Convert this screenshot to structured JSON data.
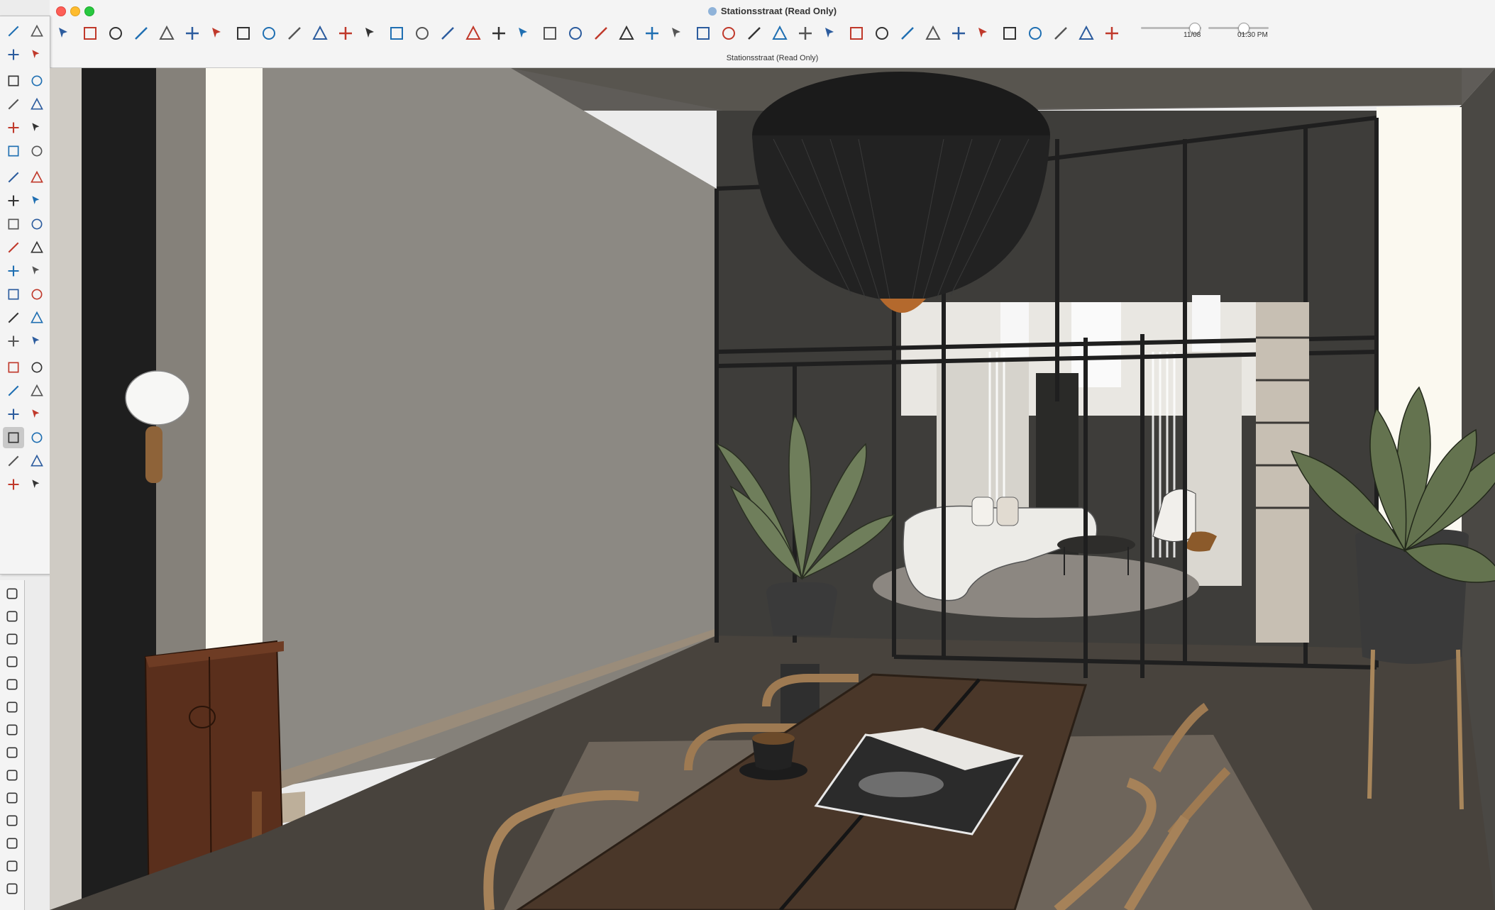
{
  "window": {
    "title": "Stationsstraat  (Read Only)",
    "subtitle": "Stationsstraat  (Read Only)"
  },
  "toolbar": {
    "tools": [
      "search",
      "select",
      "undo",
      "redo",
      "eraser",
      "pencil",
      "polygon",
      "rectangle",
      "push-pull",
      "follow-me",
      "move",
      "rotate",
      "scale",
      "protractor",
      "position-camera",
      "text",
      "paint",
      "flip",
      "orbit",
      "pan",
      "zoom",
      "zoom-extents",
      "sandbox-1",
      "sandbox-2",
      "layers",
      "layers-2",
      "shadow",
      "iso",
      "front",
      "top",
      "right",
      "back",
      "left",
      "bottom",
      "style-1",
      "style-2",
      "style-3",
      "style-4",
      "style-5",
      "style-6",
      "style-7",
      "material"
    ]
  },
  "shadow_controls": {
    "date_label": "11/08",
    "time_label": "01:30 PM",
    "date_value": 0.88,
    "time_value": 0.58
  },
  "palette": {
    "tools": [
      "select",
      "lasso",
      "paint",
      "eraser",
      "tag",
      "tape",
      "pencil",
      "freehand",
      "rectangle",
      "rotated-rectangle",
      "circle",
      "polygon",
      "arc",
      "pie",
      "push-pull",
      "follow-me",
      "move",
      "rotate",
      "scale",
      "offset",
      "tape-measure",
      "dimension",
      "protractor",
      "text",
      "axes",
      "3d-text",
      "orbit",
      "pan",
      "zoom",
      "zoom-window",
      "zoom-extents",
      "previous",
      "position-camera",
      "walk",
      "look-around",
      "section-plane",
      "sandbox",
      "sandbox-2",
      "layers",
      "layers-2"
    ]
  },
  "palette2": {
    "tools": [
      "component",
      "material",
      "scenes",
      "styles",
      "entity-info",
      "outliner",
      "tags",
      "shadows",
      "soften",
      "fog",
      "extension-warehouse",
      "instructor",
      "cart",
      "account"
    ]
  }
}
